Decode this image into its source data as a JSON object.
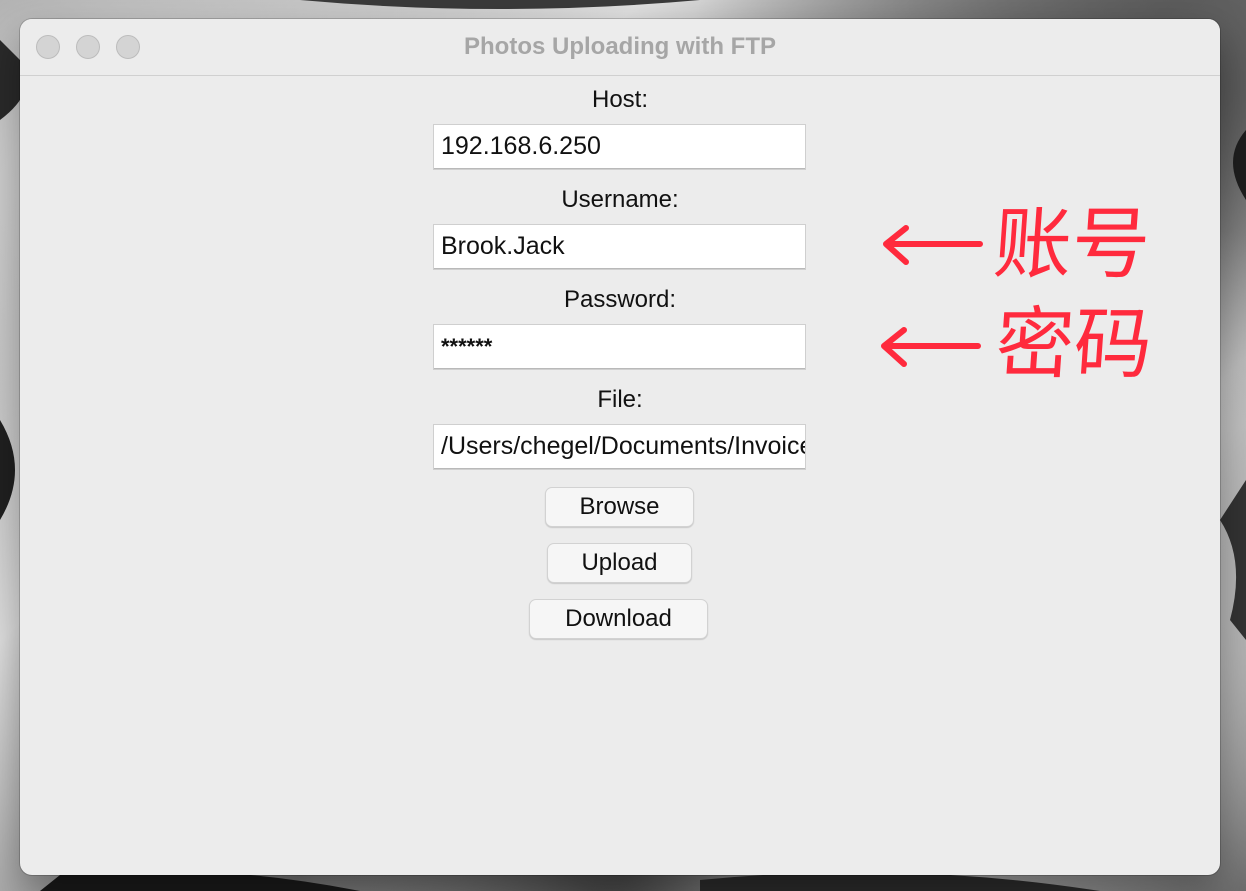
{
  "window": {
    "title": "Photos Uploading with FTP"
  },
  "form": {
    "host_label": "Host:",
    "host_value": "192.168.6.250",
    "username_label": "Username:",
    "username_value": "Brook.Jack",
    "password_label": "Password:",
    "password_value": "******",
    "file_label": "File:",
    "file_value": "/Users/chegel/Documents/Invoice"
  },
  "buttons": {
    "browse": "Browse",
    "upload": "Upload",
    "download": "Download"
  },
  "annotations": {
    "username_note": "账号",
    "password_note": "密码",
    "color": "#ff2a3d"
  }
}
